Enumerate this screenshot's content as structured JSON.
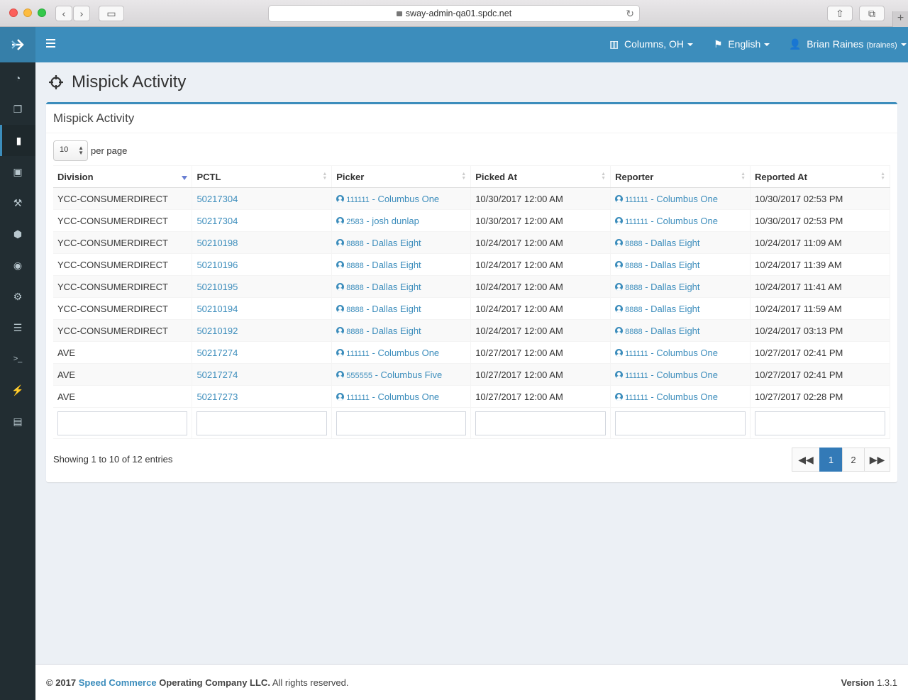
{
  "browser": {
    "url": "sway-admin-qa01.spdc.net"
  },
  "topnav": {
    "location": "Columns, OH",
    "language": "English",
    "user_name": "Brian Raines",
    "user_handle": "(braines)"
  },
  "page": {
    "title": "Mispick Activity",
    "box_title": "Mispick Activity",
    "per_page_value": "10",
    "per_page_label": "per page"
  },
  "table": {
    "columns": [
      "Division",
      "PCTL",
      "Picker",
      "Picked At",
      "Reporter",
      "Reported At"
    ],
    "rows": [
      {
        "division": "YCC-CONSUMERDIRECT",
        "pctl": "50217304",
        "picker_id": "111111",
        "picker_name": " - Columbus One",
        "picked_at": "10/30/2017 12:00 AM",
        "reporter_id": "111111",
        "reporter_name": " - Columbus One",
        "reported_at": "10/30/2017 02:53 PM"
      },
      {
        "division": "YCC-CONSUMERDIRECT",
        "pctl": "50217304",
        "picker_id": "2583",
        "picker_name": " - josh dunlap",
        "picked_at": "10/30/2017 12:00 AM",
        "reporter_id": "111111",
        "reporter_name": " - Columbus One",
        "reported_at": "10/30/2017 02:53 PM"
      },
      {
        "division": "YCC-CONSUMERDIRECT",
        "pctl": "50210198",
        "picker_id": "8888",
        "picker_name": " - Dallas Eight",
        "picked_at": "10/24/2017 12:00 AM",
        "reporter_id": "8888",
        "reporter_name": " - Dallas Eight",
        "reported_at": "10/24/2017 11:09 AM"
      },
      {
        "division": "YCC-CONSUMERDIRECT",
        "pctl": "50210196",
        "picker_id": "8888",
        "picker_name": " - Dallas Eight",
        "picked_at": "10/24/2017 12:00 AM",
        "reporter_id": "8888",
        "reporter_name": " - Dallas Eight",
        "reported_at": "10/24/2017 11:39 AM"
      },
      {
        "division": "YCC-CONSUMERDIRECT",
        "pctl": "50210195",
        "picker_id": "8888",
        "picker_name": " - Dallas Eight",
        "picked_at": "10/24/2017 12:00 AM",
        "reporter_id": "8888",
        "reporter_name": " - Dallas Eight",
        "reported_at": "10/24/2017 11:41 AM"
      },
      {
        "division": "YCC-CONSUMERDIRECT",
        "pctl": "50210194",
        "picker_id": "8888",
        "picker_name": " - Dallas Eight",
        "picked_at": "10/24/2017 12:00 AM",
        "reporter_id": "8888",
        "reporter_name": " - Dallas Eight",
        "reported_at": "10/24/2017 11:59 AM"
      },
      {
        "division": "YCC-CONSUMERDIRECT",
        "pctl": "50210192",
        "picker_id": "8888",
        "picker_name": " - Dallas Eight",
        "picked_at": "10/24/2017 12:00 AM",
        "reporter_id": "8888",
        "reporter_name": " - Dallas Eight",
        "reported_at": "10/24/2017 03:13 PM"
      },
      {
        "division": "AVE",
        "pctl": "50217274",
        "picker_id": "111111",
        "picker_name": " - Columbus One",
        "picked_at": "10/27/2017 12:00 AM",
        "reporter_id": "111111",
        "reporter_name": " - Columbus One",
        "reported_at": "10/27/2017 02:41 PM"
      },
      {
        "division": "AVE",
        "pctl": "50217274",
        "picker_id": "555555",
        "picker_name": " - Columbus Five",
        "picked_at": "10/27/2017 12:00 AM",
        "reporter_id": "111111",
        "reporter_name": " - Columbus One",
        "reported_at": "10/27/2017 02:41 PM"
      },
      {
        "division": "AVE",
        "pctl": "50217273",
        "picker_id": "111111",
        "picker_name": " - Columbus One",
        "picked_at": "10/27/2017 12:00 AM",
        "reporter_id": "111111",
        "reporter_name": " - Columbus One",
        "reported_at": "10/27/2017 02:28 PM"
      }
    ]
  },
  "pagination": {
    "info": "Showing 1 to 10 of 12 entries",
    "first": "«",
    "pages": [
      "1",
      "2"
    ],
    "last": "»",
    "current": "1"
  },
  "footer": {
    "copyright": "© 2017",
    "company_link": "Speed Commerce",
    "company_rest": "Operating Company LLC.",
    "rights": "All rights reserved.",
    "version_label": "Version",
    "version": "1.3.1"
  },
  "colors": {
    "brand": "#3c8dbc",
    "sidebar": "#222d32",
    "content_bg": "#ecf0f5"
  }
}
